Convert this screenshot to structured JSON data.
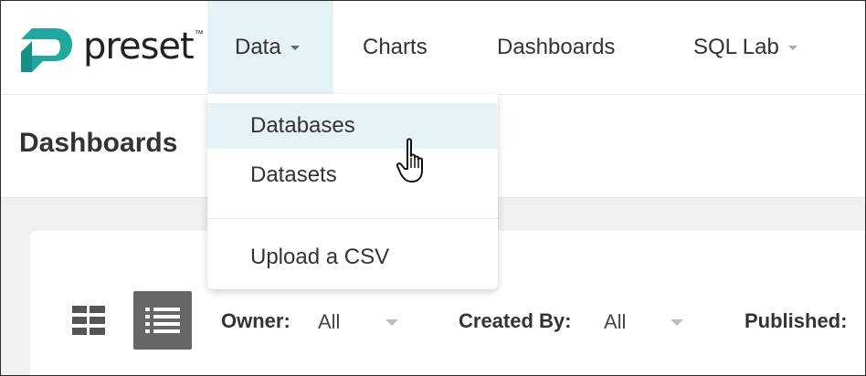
{
  "brand": {
    "name": "preset",
    "tm": "™",
    "accent_color": "#20a7a0"
  },
  "nav": {
    "items": [
      {
        "label": "Data",
        "has_caret": true,
        "active": true
      },
      {
        "label": "Charts",
        "has_caret": false,
        "active": false
      },
      {
        "label": "Dashboards",
        "has_caret": false,
        "active": false
      },
      {
        "label": "SQL Lab",
        "has_caret": true,
        "active": false
      }
    ]
  },
  "page": {
    "title": "Dashboards"
  },
  "data_menu": {
    "items": [
      {
        "label": "Databases",
        "hovered": true
      },
      {
        "label": "Datasets",
        "hovered": false
      },
      {
        "label": "Upload a CSV",
        "hovered": false
      }
    ]
  },
  "view_toggle": {
    "card_icon": "grid-icon",
    "list_icon": "list-icon",
    "selected": "list"
  },
  "filters": [
    {
      "label": "Owner:",
      "value": "All"
    },
    {
      "label": "Created By:",
      "value": "All"
    },
    {
      "label": "Published:",
      "value": ""
    }
  ],
  "colors": {
    "active_bg": "#e5f2f6",
    "selected_toggle": "#666666"
  }
}
